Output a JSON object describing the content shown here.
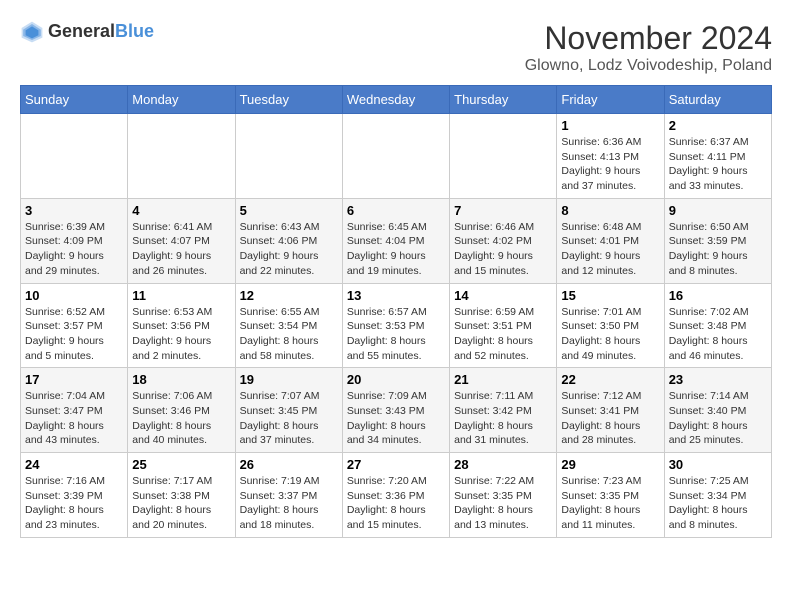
{
  "logo": {
    "general": "General",
    "blue": "Blue"
  },
  "title": "November 2024",
  "location": "Glowno, Lodz Voivodeship, Poland",
  "days_of_week": [
    "Sunday",
    "Monday",
    "Tuesday",
    "Wednesday",
    "Thursday",
    "Friday",
    "Saturday"
  ],
  "weeks": [
    [
      {
        "day": "",
        "info": ""
      },
      {
        "day": "",
        "info": ""
      },
      {
        "day": "",
        "info": ""
      },
      {
        "day": "",
        "info": ""
      },
      {
        "day": "",
        "info": ""
      },
      {
        "day": "1",
        "info": "Sunrise: 6:36 AM\nSunset: 4:13 PM\nDaylight: 9 hours and 37 minutes."
      },
      {
        "day": "2",
        "info": "Sunrise: 6:37 AM\nSunset: 4:11 PM\nDaylight: 9 hours and 33 minutes."
      }
    ],
    [
      {
        "day": "3",
        "info": "Sunrise: 6:39 AM\nSunset: 4:09 PM\nDaylight: 9 hours and 29 minutes."
      },
      {
        "day": "4",
        "info": "Sunrise: 6:41 AM\nSunset: 4:07 PM\nDaylight: 9 hours and 26 minutes."
      },
      {
        "day": "5",
        "info": "Sunrise: 6:43 AM\nSunset: 4:06 PM\nDaylight: 9 hours and 22 minutes."
      },
      {
        "day": "6",
        "info": "Sunrise: 6:45 AM\nSunset: 4:04 PM\nDaylight: 9 hours and 19 minutes."
      },
      {
        "day": "7",
        "info": "Sunrise: 6:46 AM\nSunset: 4:02 PM\nDaylight: 9 hours and 15 minutes."
      },
      {
        "day": "8",
        "info": "Sunrise: 6:48 AM\nSunset: 4:01 PM\nDaylight: 9 hours and 12 minutes."
      },
      {
        "day": "9",
        "info": "Sunrise: 6:50 AM\nSunset: 3:59 PM\nDaylight: 9 hours and 8 minutes."
      }
    ],
    [
      {
        "day": "10",
        "info": "Sunrise: 6:52 AM\nSunset: 3:57 PM\nDaylight: 9 hours and 5 minutes."
      },
      {
        "day": "11",
        "info": "Sunrise: 6:53 AM\nSunset: 3:56 PM\nDaylight: 9 hours and 2 minutes."
      },
      {
        "day": "12",
        "info": "Sunrise: 6:55 AM\nSunset: 3:54 PM\nDaylight: 8 hours and 58 minutes."
      },
      {
        "day": "13",
        "info": "Sunrise: 6:57 AM\nSunset: 3:53 PM\nDaylight: 8 hours and 55 minutes."
      },
      {
        "day": "14",
        "info": "Sunrise: 6:59 AM\nSunset: 3:51 PM\nDaylight: 8 hours and 52 minutes."
      },
      {
        "day": "15",
        "info": "Sunrise: 7:01 AM\nSunset: 3:50 PM\nDaylight: 8 hours and 49 minutes."
      },
      {
        "day": "16",
        "info": "Sunrise: 7:02 AM\nSunset: 3:48 PM\nDaylight: 8 hours and 46 minutes."
      }
    ],
    [
      {
        "day": "17",
        "info": "Sunrise: 7:04 AM\nSunset: 3:47 PM\nDaylight: 8 hours and 43 minutes."
      },
      {
        "day": "18",
        "info": "Sunrise: 7:06 AM\nSunset: 3:46 PM\nDaylight: 8 hours and 40 minutes."
      },
      {
        "day": "19",
        "info": "Sunrise: 7:07 AM\nSunset: 3:45 PM\nDaylight: 8 hours and 37 minutes."
      },
      {
        "day": "20",
        "info": "Sunrise: 7:09 AM\nSunset: 3:43 PM\nDaylight: 8 hours and 34 minutes."
      },
      {
        "day": "21",
        "info": "Sunrise: 7:11 AM\nSunset: 3:42 PM\nDaylight: 8 hours and 31 minutes."
      },
      {
        "day": "22",
        "info": "Sunrise: 7:12 AM\nSunset: 3:41 PM\nDaylight: 8 hours and 28 minutes."
      },
      {
        "day": "23",
        "info": "Sunrise: 7:14 AM\nSunset: 3:40 PM\nDaylight: 8 hours and 25 minutes."
      }
    ],
    [
      {
        "day": "24",
        "info": "Sunrise: 7:16 AM\nSunset: 3:39 PM\nDaylight: 8 hours and 23 minutes."
      },
      {
        "day": "25",
        "info": "Sunrise: 7:17 AM\nSunset: 3:38 PM\nDaylight: 8 hours and 20 minutes."
      },
      {
        "day": "26",
        "info": "Sunrise: 7:19 AM\nSunset: 3:37 PM\nDaylight: 8 hours and 18 minutes."
      },
      {
        "day": "27",
        "info": "Sunrise: 7:20 AM\nSunset: 3:36 PM\nDaylight: 8 hours and 15 minutes."
      },
      {
        "day": "28",
        "info": "Sunrise: 7:22 AM\nSunset: 3:35 PM\nDaylight: 8 hours and 13 minutes."
      },
      {
        "day": "29",
        "info": "Sunrise: 7:23 AM\nSunset: 3:35 PM\nDaylight: 8 hours and 11 minutes."
      },
      {
        "day": "30",
        "info": "Sunrise: 7:25 AM\nSunset: 3:34 PM\nDaylight: 8 hours and 8 minutes."
      }
    ]
  ]
}
